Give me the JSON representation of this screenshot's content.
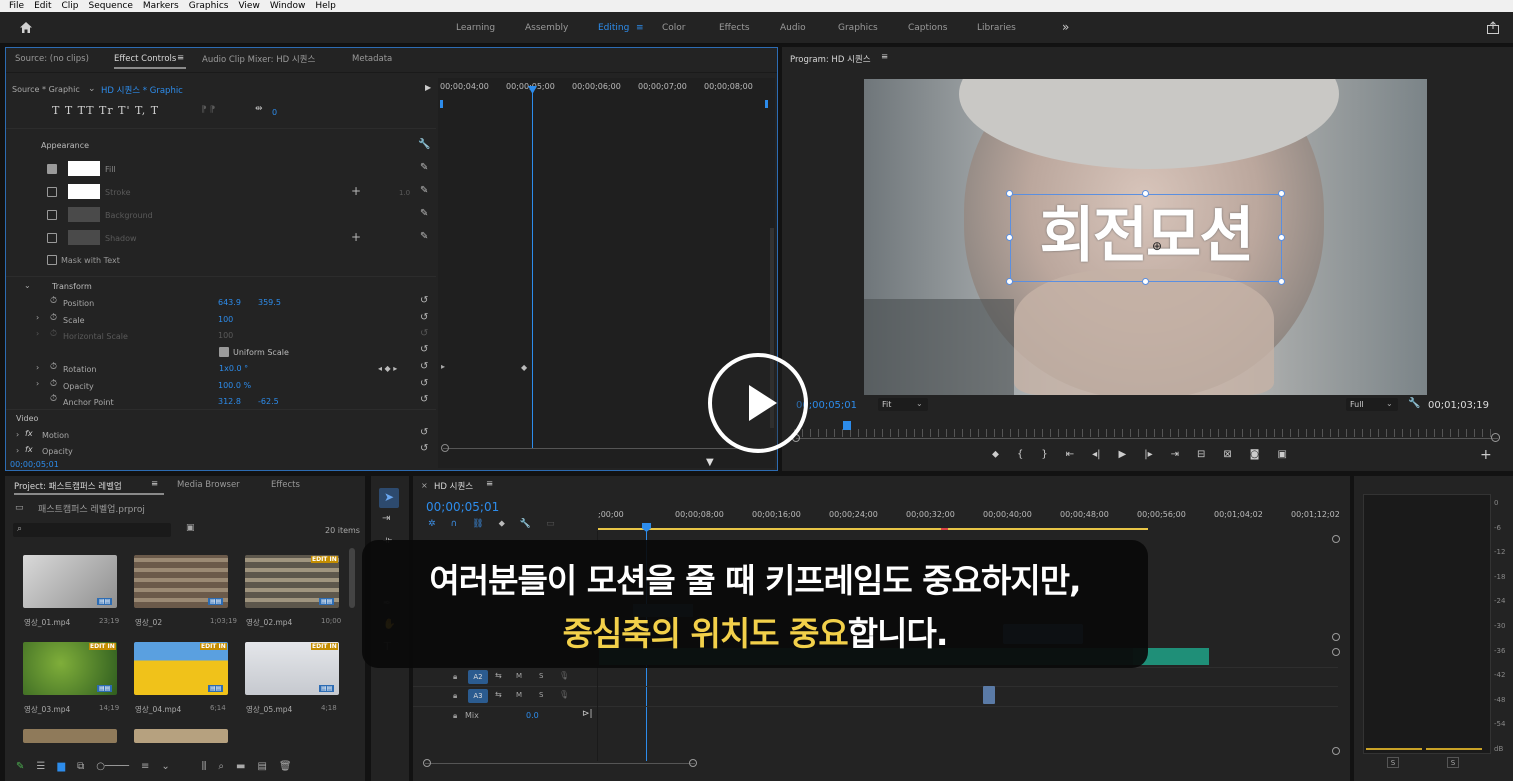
{
  "menu": [
    "File",
    "Edit",
    "Clip",
    "Sequence",
    "Markers",
    "Graphics",
    "View",
    "Window",
    "Help"
  ],
  "workspaces": {
    "learning": "Learning",
    "assembly": "Assembly",
    "editing": "Editing",
    "color": "Color",
    "effects": "Effects",
    "audio": "Audio",
    "graphics": "Graphics",
    "captions": "Captions",
    "libraries": "Libraries",
    "more": "»"
  },
  "source_panel": {
    "tabs": {
      "source": "Source: (no clips)",
      "effect_controls": "Effect Controls",
      "audio_mixer": "Audio Clip Mixer: HD 시퀀스",
      "metadata": "Metadata"
    },
    "breadcrumb_source": "Source * Graphic",
    "breadcrumb_seq": "HD 시퀀스 * Graphic",
    "ruler": [
      "00;00;04;00",
      "00;00;05;00",
      "00;00;06;00",
      "00;00;07;00",
      "00;00;08;00"
    ],
    "text_tools": "T  T  TT Tr  T'  T,  T",
    "tracking_value": "0",
    "appearance": "Appearance",
    "fill": "Fill",
    "stroke": "Stroke",
    "stroke_width": "1.0",
    "background": "Background",
    "shadow": "Shadow",
    "mask": "Mask with Text",
    "transform": "Transform",
    "position": "Position",
    "position_x": "643.9",
    "position_y": "359.5",
    "scale": "Scale",
    "scale_val": "100",
    "hscale": "Horizontal Scale",
    "hscale_val": "100",
    "uniform": "Uniform Scale",
    "rotation": "Rotation",
    "rotation_val": "1x0.0 °",
    "opacity": "Opacity",
    "opacity_val": "100.0 %",
    "anchor": "Anchor Point",
    "anchor_x": "312.8",
    "anchor_y": "-62.5",
    "video": "Video",
    "motion": "Motion",
    "opacity2": "Opacity",
    "timecode": "00;00;05;01"
  },
  "program": {
    "title": "Program: HD 시퀀스",
    "overlay_text": "회전모션",
    "timecode": "00;00;05;01",
    "fit": "Fit",
    "full": "Full",
    "duration": "00;01;03;19"
  },
  "project": {
    "tabs": {
      "project": "Project: 패스트캠퍼스 레벨업",
      "media": "Media Browser",
      "effects": "Effects"
    },
    "file": "패스트캠퍼스 레벨업.prproj",
    "count": "20 items",
    "items": [
      {
        "name": "영상_01.mp4",
        "dur": "23;19"
      },
      {
        "name": "영상_02",
        "dur": "1;03;19"
      },
      {
        "name": "영상_02.mp4",
        "dur": "10;00"
      },
      {
        "name": "영상_03.mp4",
        "dur": "14;19"
      },
      {
        "name": "영상_04.mp4",
        "dur": "6;14"
      },
      {
        "name": "영상_05.mp4",
        "dur": "4;18"
      }
    ],
    "badge": "EDIT IN"
  },
  "timeline": {
    "title": "HD 시퀀스",
    "timecode": "00;00;05;01",
    "ruler": [
      ";00;00",
      "00;00;08;00",
      "00;00;16;00",
      "00;00;24;00",
      "00;00;32;00",
      "00;00;40;00",
      "00;00;48;00",
      "00;00;56;00",
      "00;01;04;02",
      "00;01;12;02"
    ],
    "a2": "A2",
    "a3": "A3",
    "mix": "Mix",
    "mix_val": "0.0",
    "m": "M",
    "s": "S"
  },
  "meter": {
    "scale": [
      "0",
      "-6",
      "-12",
      "-18",
      "-24",
      "-30",
      "-36",
      "-42",
      "-48",
      "-54",
      "dB"
    ],
    "s": "S"
  },
  "play_overlay": {
    "label": "play"
  },
  "subtitle": {
    "line1": "여러분들이 모션을 줄 때 키프레임도 중요하지만,",
    "line2_highlight": "중심축의 위치도 중요",
    "line2_rest": "합니다."
  },
  "colors": {
    "accent": "#2d8ceb",
    "subtitle_highlight": "#f2d04a",
    "audio_clip": "#1f8f78"
  }
}
